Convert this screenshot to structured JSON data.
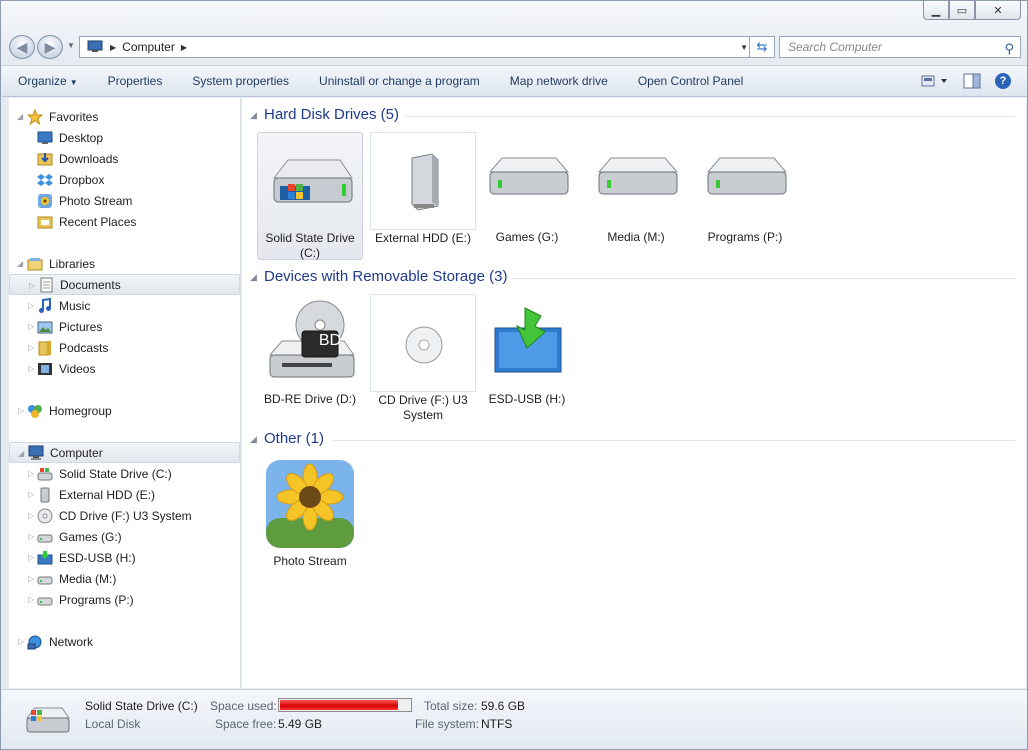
{
  "address": {
    "location": "Computer",
    "search_placeholder": "Search Computer"
  },
  "toolbar": {
    "organize": "Organize",
    "properties": "Properties",
    "system_properties": "System properties",
    "uninstall": "Uninstall or change a program",
    "map_drive": "Map network drive",
    "control_panel": "Open Control Panel",
    "help": "?"
  },
  "sidebar": {
    "favorites": "Favorites",
    "fav_items": [
      "Desktop",
      "Downloads",
      "Dropbox",
      "Photo Stream",
      "Recent Places"
    ],
    "libraries": "Libraries",
    "lib_items": [
      "Documents",
      "Music",
      "Pictures",
      "Podcasts",
      "Videos"
    ],
    "homegroup": "Homegroup",
    "computer": "Computer",
    "comp_items": [
      "Solid State Drive (C:)",
      "External HDD (E:)",
      "CD Drive (F:) U3 System",
      "Games (G:)",
      "ESD-USB (H:)",
      "Media (M:)",
      "Programs (P:)"
    ],
    "network": "Network"
  },
  "groups": {
    "hdd": "Hard Disk Drives (5)",
    "removable": "Devices with Removable Storage (3)",
    "other": "Other (1)"
  },
  "hdd_tiles": [
    "Solid State Drive (C:)",
    "External HDD (E:)",
    "Games (G:)",
    "Media (M:)",
    "Programs (P:)"
  ],
  "removable_tiles": [
    "BD-RE Drive (D:)",
    "CD Drive (F:) U3 System",
    "ESD-USB (H:)"
  ],
  "bd_badge": "BD",
  "other_tiles": [
    "Photo Stream"
  ],
  "details": {
    "name": "Solid State Drive (C:)",
    "type": "Local Disk",
    "space_used_label": "Space used:",
    "space_used_fraction": 0.908,
    "space_free_label": "Space free:",
    "space_free": "5.49 GB",
    "total_size_label": "Total size:",
    "total_size": "59.6 GB",
    "file_system_label": "File system:",
    "file_system": "NTFS"
  },
  "colors": {
    "used_bar": "#d40000",
    "group_header": "#1e3a8a",
    "accent": "#2a64b8"
  }
}
